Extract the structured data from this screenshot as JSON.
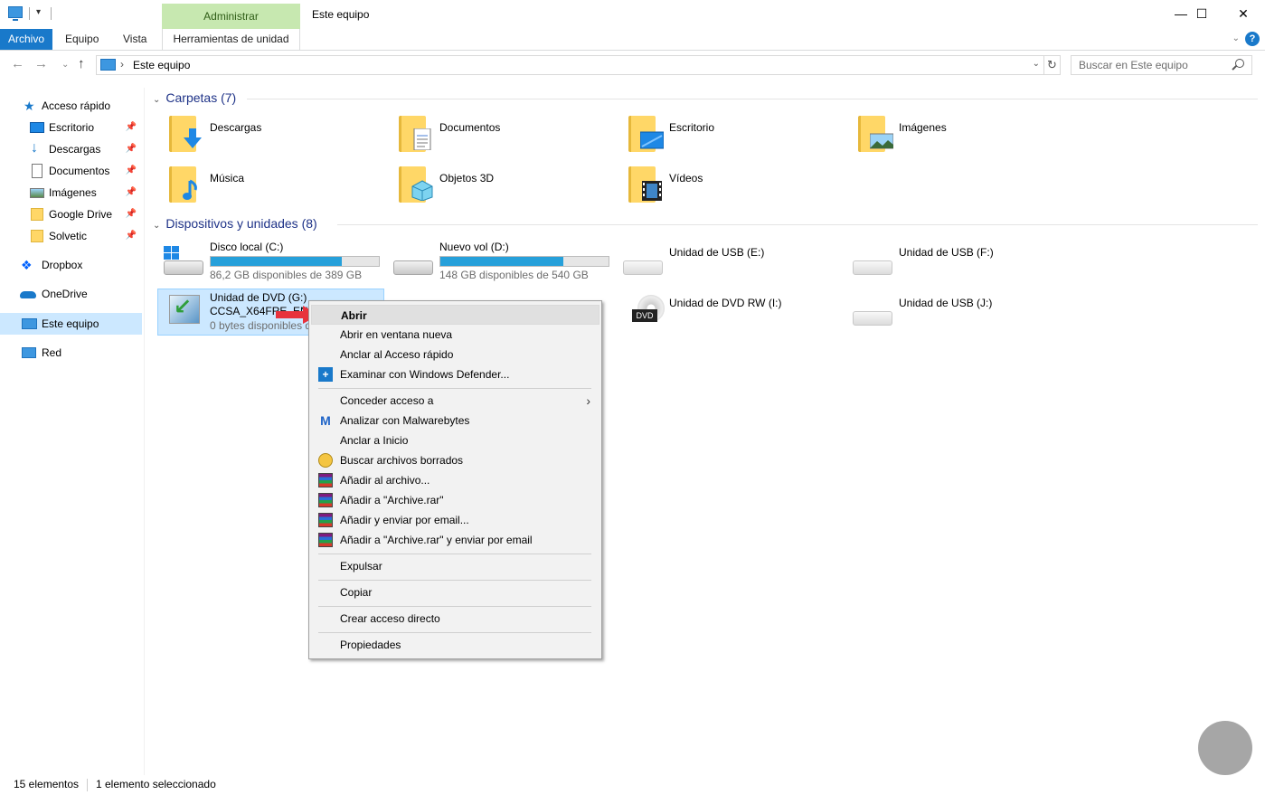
{
  "window": {
    "title": "Este equipo",
    "context_tab_group": "Administrar"
  },
  "ribbon": {
    "tabs": [
      "Archivo",
      "Equipo",
      "Vista",
      "Herramientas de unidad"
    ]
  },
  "address": {
    "path": "Este equipo",
    "search_placeholder": "Buscar en Este equipo"
  },
  "sidebar": {
    "quick_access": "Acceso rápido",
    "items": [
      {
        "label": "Escritorio",
        "pinned": true,
        "icon": "desktop-icon"
      },
      {
        "label": "Descargas",
        "pinned": true,
        "icon": "download-icon"
      },
      {
        "label": "Documentos",
        "pinned": true,
        "icon": "documents-icon"
      },
      {
        "label": "Imágenes",
        "pinned": true,
        "icon": "pictures-icon"
      },
      {
        "label": "Google Drive",
        "pinned": true,
        "icon": "folder-icon"
      },
      {
        "label": "Solvetic",
        "pinned": true,
        "icon": "folder-icon"
      }
    ],
    "dropbox": "Dropbox",
    "onedrive": "OneDrive",
    "this_pc": "Este equipo",
    "network": "Red"
  },
  "folders_section": {
    "title": "Carpetas (7)",
    "folders": [
      "Descargas",
      "Documentos",
      "Escritorio",
      "Imágenes",
      "Música",
      "Objetos 3D",
      "Vídeos"
    ]
  },
  "devices_section": {
    "title": "Dispositivos y unidades (8)",
    "drives": [
      {
        "name": "Disco local (C:)",
        "free": "86,2 GB disponibles de 389 GB",
        "used_fraction": 0.78
      },
      {
        "name": "Nuevo vol (D:)",
        "free": "148 GB disponibles de 540 GB",
        "used_fraction": 0.73
      },
      {
        "name": "Unidad de USB (E:)"
      },
      {
        "name": "Unidad de USB (F:)"
      },
      {
        "name": "Unidad de DVD (G:)",
        "label2": "CCSA_X64FRE_EN-US",
        "free": "0 bytes disponibles d"
      },
      {
        "name": "Unidad de DVD RW (I:)",
        "badge": "DVD"
      },
      {
        "name": "Unidad de USB (J:)"
      }
    ]
  },
  "context_menu": {
    "items": [
      "Abrir",
      "Abrir en ventana nueva",
      "Anclar al Acceso rápido",
      "Examinar con Windows Defender...",
      "Conceder acceso a",
      "Analizar con Malwarebytes",
      "Anclar a Inicio",
      "Buscar archivos borrados",
      "Añadir al archivo...",
      "Añadir a \"Archive.rar\"",
      "Añadir y enviar por email...",
      "Añadir a \"Archive.rar\" y enviar por email",
      "Expulsar",
      "Copiar",
      "Crear acceso directo",
      "Propiedades"
    ]
  },
  "status": {
    "count": "15 elementos",
    "selected": "1 elemento seleccionado"
  },
  "colors": {
    "accent": "#1979ca",
    "selection": "#cce8ff",
    "context_tab": "#c7e8b0",
    "drive_bar": "#26a0da"
  }
}
